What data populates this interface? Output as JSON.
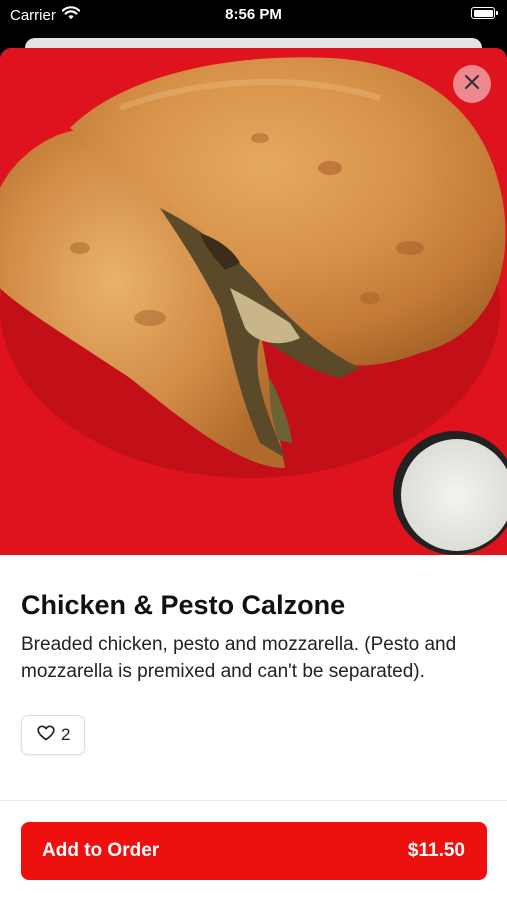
{
  "status_bar": {
    "carrier": "Carrier",
    "time": "8:56 PM"
  },
  "item": {
    "name": "Chicken & Pesto Calzone",
    "description": "Breaded chicken, pesto and mozzarella. (Pesto and mozzarella is premixed and can't be separated).",
    "likes": "2",
    "image_icon": "calzone-photo"
  },
  "actions": {
    "add_label": "Add to Order",
    "price": "$11.50"
  },
  "colors": {
    "accent": "#ee0f0f",
    "image_background": "#e3141f",
    "close_button": "#f0888f"
  },
  "icons": {
    "close": "close-icon",
    "like": "heart-icon",
    "wifi": "wifi-icon",
    "battery": "battery-icon"
  }
}
